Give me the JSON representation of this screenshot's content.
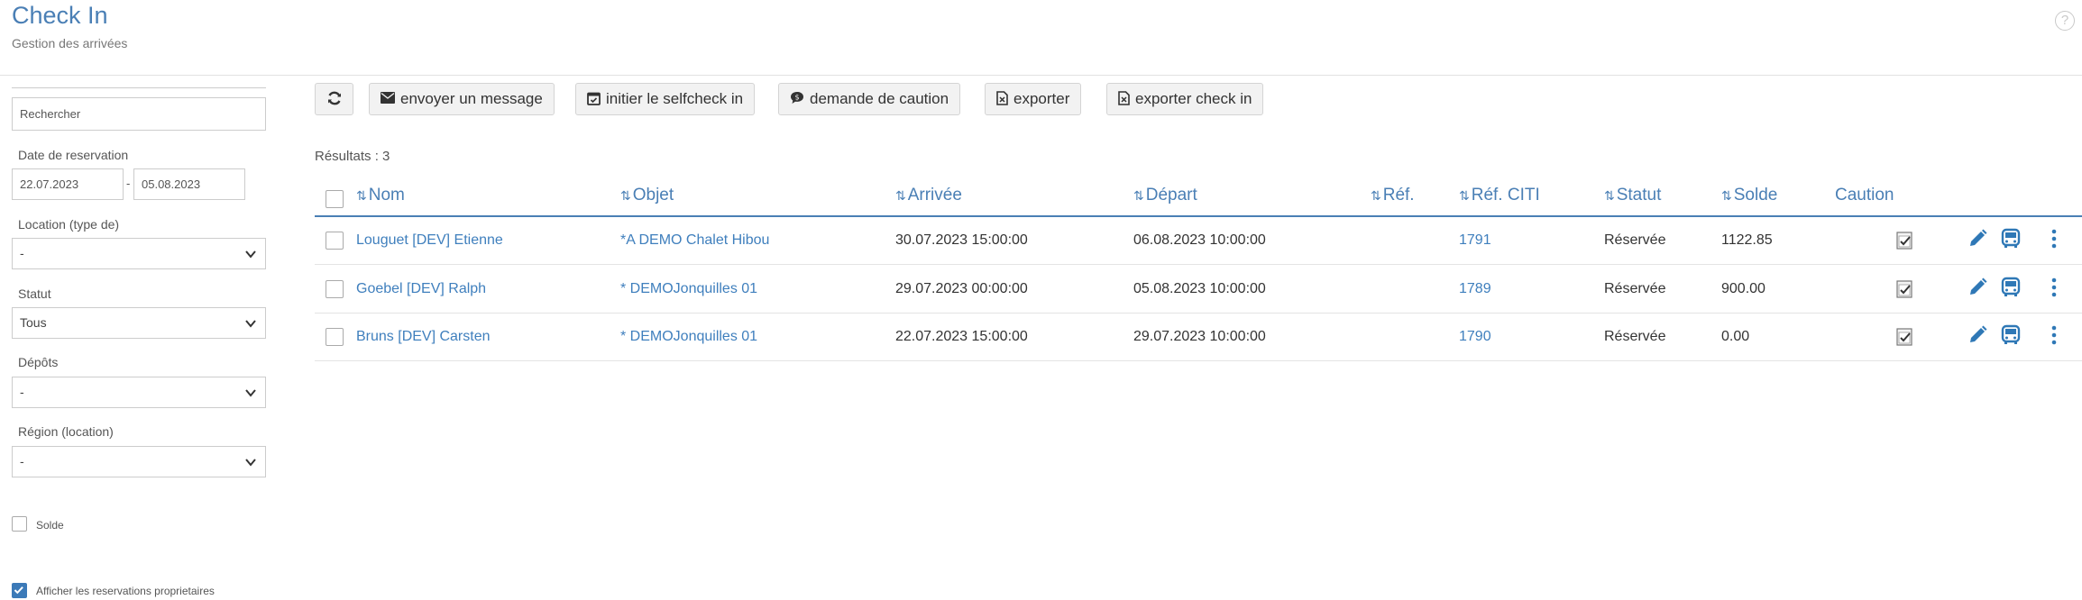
{
  "header": {
    "title": "Check In",
    "subtitle": "Gestion des arrivées",
    "help_glyph": "?"
  },
  "sidebar": {
    "search_placeholder": "Rechercher",
    "date_label": "Date de reservation",
    "date_from": "22.07.2023",
    "date_separator": "-",
    "date_to": "05.08.2023",
    "location_label": "Location (type de)",
    "location_value": "-",
    "statut_label": "Statut",
    "statut_value": "Tous",
    "depots_label": "Dépôts",
    "depots_value": "-",
    "region_label": "Région (location)",
    "region_value": "-",
    "solde_label": "Solde",
    "solde_checked": false,
    "proprietaires_label": "Afficher les reservations proprietaires",
    "proprietaires_checked": true
  },
  "toolbar": {
    "refresh_icon": "refresh-icon",
    "send_message": "envoyer un message",
    "selfcheck": "initier le selfcheck in",
    "caution": "demande de caution",
    "export": "exporter",
    "export_checkin": "exporter check in"
  },
  "results_text": "Résultats : 3",
  "table": {
    "headers": {
      "nom": "Nom",
      "objet": "Objet",
      "arrivee": "Arrivée",
      "depart": "Départ",
      "ref": "Réf.",
      "ref_citi": "Réf. CITI",
      "statut": "Statut",
      "solde": "Solde",
      "caution": "Caution"
    },
    "rows": [
      {
        "nom": "Louguet [DEV] Etienne",
        "objet": "*A DEMO Chalet Hibou",
        "arrivee": "30.07.2023 15:00:00",
        "depart": "06.08.2023 10:00:00",
        "ref": "",
        "ref_citi": "1791",
        "statut": "Réservée",
        "solde": "1122.85"
      },
      {
        "nom": "Goebel [DEV] Ralph",
        "objet": "* DEMOJonquilles 01",
        "arrivee": "29.07.2023 00:00:00",
        "depart": "05.08.2023 10:00:00",
        "ref": "",
        "ref_citi": "1789",
        "statut": "Réservée",
        "solde": "900.00"
      },
      {
        "nom": "Bruns [DEV] Carsten",
        "objet": "* DEMOJonquilles 01",
        "arrivee": "22.07.2023 15:00:00",
        "depart": "29.07.2023 10:00:00",
        "ref": "",
        "ref_citi": "1790",
        "statut": "Réservée",
        "solde": "0.00"
      }
    ]
  },
  "colors": {
    "accent": "#4a7fb5",
    "link": "#3f7fbd",
    "checkbox_on": "#3c7ab8"
  }
}
